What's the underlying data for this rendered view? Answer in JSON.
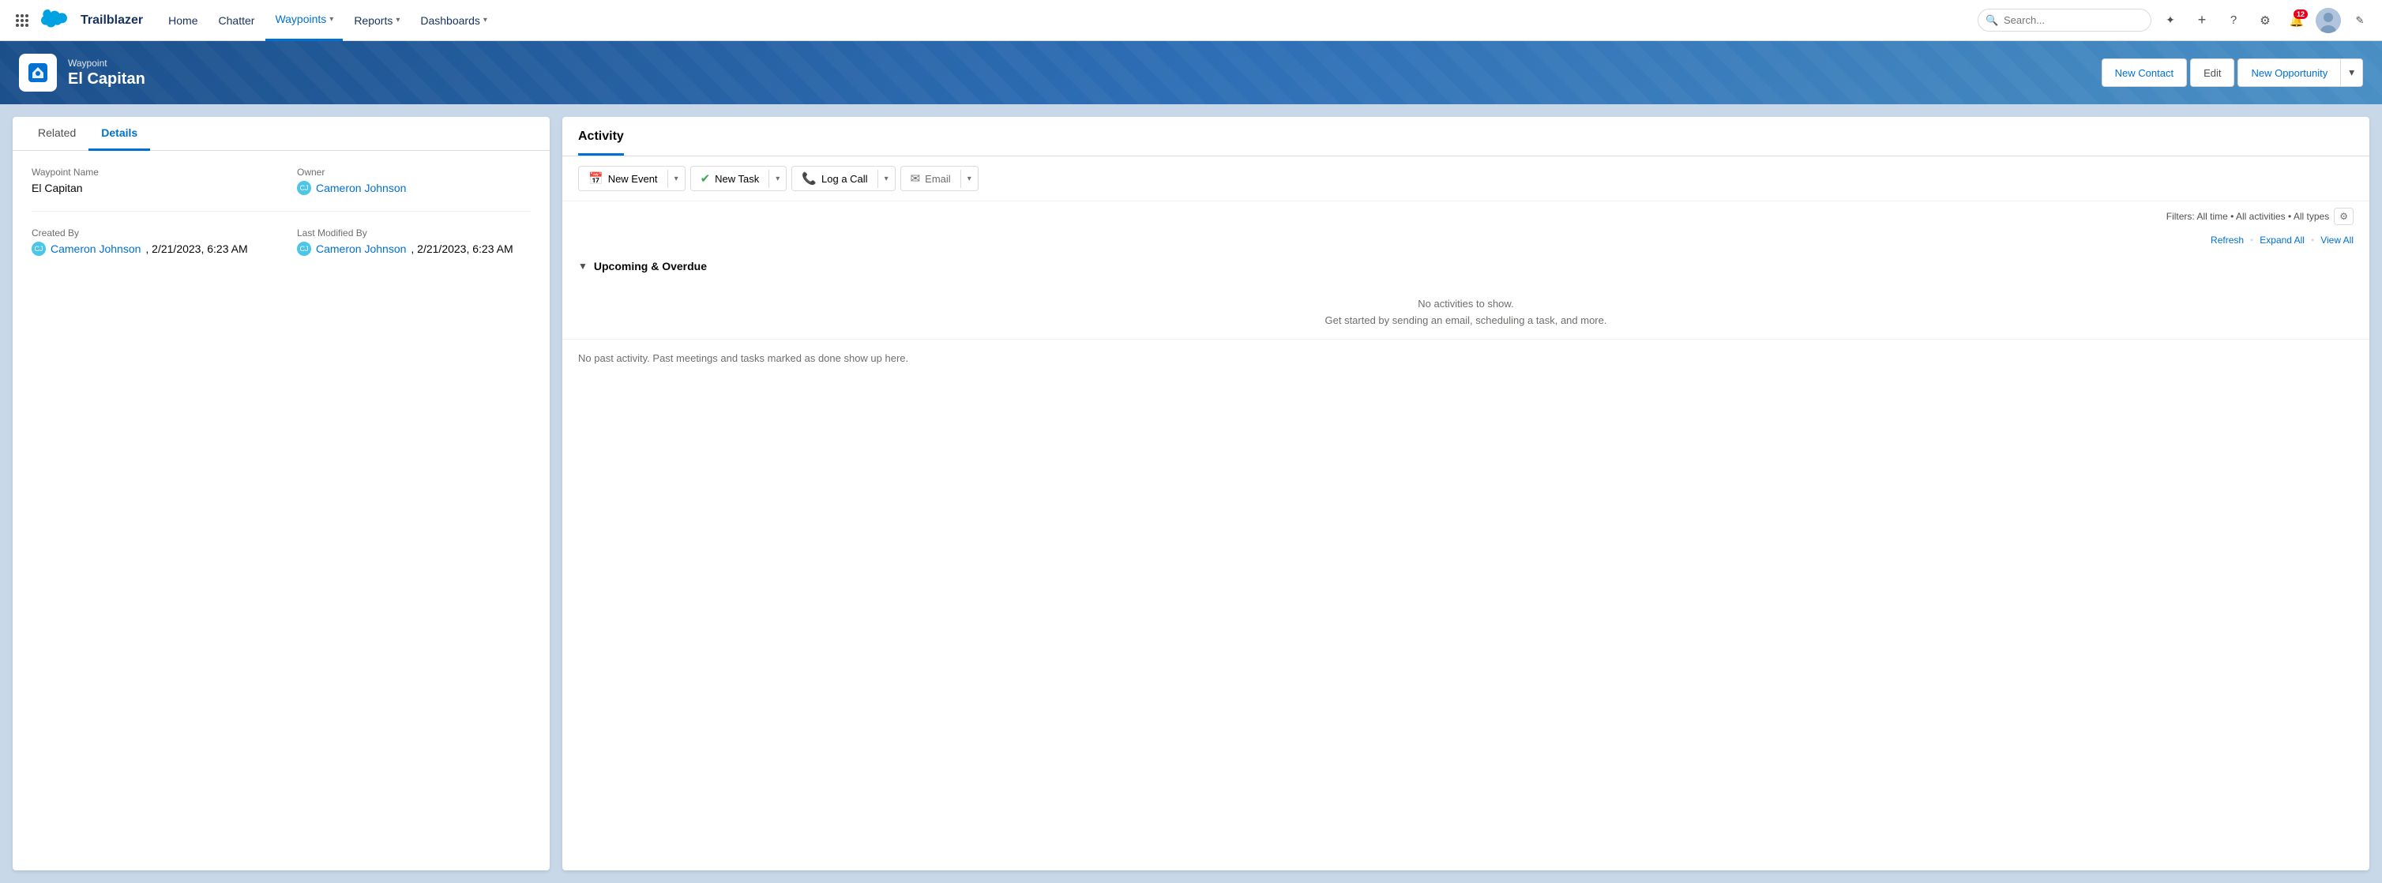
{
  "app": {
    "name": "Trailblazer",
    "logo_alt": "Salesforce"
  },
  "nav": {
    "items": [
      {
        "id": "home",
        "label": "Home",
        "active": false,
        "has_dropdown": false
      },
      {
        "id": "chatter",
        "label": "Chatter",
        "active": false,
        "has_dropdown": false
      },
      {
        "id": "waypoints",
        "label": "Waypoints",
        "active": true,
        "has_dropdown": true
      },
      {
        "id": "reports",
        "label": "Reports",
        "active": false,
        "has_dropdown": true
      },
      {
        "id": "dashboards",
        "label": "Dashboards",
        "active": false,
        "has_dropdown": true
      }
    ],
    "notification_count": "12",
    "search_placeholder": "Search..."
  },
  "header": {
    "breadcrumb": "Waypoint",
    "title": "El Capitan",
    "actions": {
      "new_contact_label": "New Contact",
      "edit_label": "Edit",
      "new_opportunity_label": "New Opportunity"
    }
  },
  "left_panel": {
    "tabs": [
      {
        "id": "related",
        "label": "Related",
        "active": false
      },
      {
        "id": "details",
        "label": "Details",
        "active": true
      }
    ],
    "fields": {
      "waypoint_name_label": "Waypoint Name",
      "waypoint_name_value": "El Capitan",
      "owner_label": "Owner",
      "owner_name": "Cameron Johnson",
      "created_by_label": "Created By",
      "created_by_name": "Cameron Johnson",
      "created_by_date": ", 2/21/2023, 6:23 AM",
      "last_modified_label": "Last Modified By",
      "last_modified_name": "Cameron Johnson",
      "last_modified_date": ", 2/21/2023, 6:23 AM"
    }
  },
  "right_panel": {
    "title": "Activity",
    "action_buttons": [
      {
        "id": "new-event",
        "label": "New Event",
        "icon": "calendar",
        "color": "#e07000"
      },
      {
        "id": "new-task",
        "label": "New Task",
        "icon": "task",
        "color": "#3ba755"
      },
      {
        "id": "log-call",
        "label": "Log a Call",
        "icon": "call",
        "color": "#4bc6e8"
      },
      {
        "id": "email",
        "label": "Email",
        "icon": "email",
        "color": "#706e6b"
      }
    ],
    "filters_text": "Filters: All time • All activities • All types",
    "links": {
      "refresh": "Refresh",
      "expand_all": "Expand All",
      "view_all": "View All"
    },
    "upcoming_section": {
      "title": "Upcoming & Overdue",
      "empty_line1": "No activities to show.",
      "empty_line2": "Get started by sending an email, scheduling a task, and more."
    },
    "past_activity_note": "No past activity. Past meetings and tasks marked as done show up here."
  }
}
